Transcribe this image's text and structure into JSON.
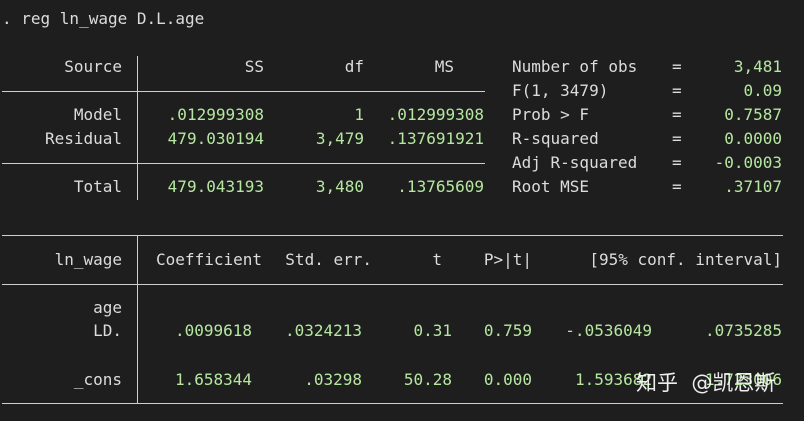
{
  "command": ". reg ln_wage D.L.age",
  "anova": {
    "headers": [
      "Source",
      "SS",
      "df",
      "MS"
    ],
    "rows": [
      {
        "source": "Model",
        "ss": ".012999308",
        "df": "1",
        "ms": ".012999308"
      },
      {
        "source": "Residual",
        "ss": "479.030194",
        "df": "3,479",
        "ms": ".137691921"
      },
      {
        "source": "Total",
        "ss": "479.043193",
        "df": "3,480",
        "ms": ".13765609"
      }
    ]
  },
  "stats": [
    {
      "label": "Number of obs",
      "eq": "=",
      "value": "3,481"
    },
    {
      "label": "F(1, 3479)",
      "eq": "=",
      "value": "0.09"
    },
    {
      "label": "Prob > F",
      "eq": "=",
      "value": "0.7587"
    },
    {
      "label": "R-squared",
      "eq": "=",
      "value": "0.0000"
    },
    {
      "label": "Adj R-squared",
      "eq": "=",
      "value": "-0.0003"
    },
    {
      "label": "Root MSE",
      "eq": "=",
      "value": ".37107"
    }
  ],
  "coef": {
    "headers": [
      "ln_wage",
      "Coefficient",
      "Std. err.",
      "t",
      "P>|t|",
      "[95% conf. interval]"
    ],
    "group_label": "age",
    "rows": [
      {
        "name": "LD.",
        "coef": ".0099618",
        "se": ".0324213",
        "t": "0.31",
        "p": "0.759",
        "ci_lo": "-.0536049",
        "ci_hi": ".0735285"
      },
      {
        "name": "_cons",
        "coef": "1.658344",
        "se": ".03298",
        "t": "50.28",
        "p": "0.000",
        "ci_lo": "1.593682",
        "ci_hi": "1.723006"
      }
    ]
  },
  "watermark": {
    "site": "知乎",
    "handle": "@凯恩斯"
  },
  "colors": {
    "background": "#1e1e1e",
    "text": "#dcdcdc",
    "values": "#b5e7a0",
    "rules": "#cfcfcf"
  }
}
